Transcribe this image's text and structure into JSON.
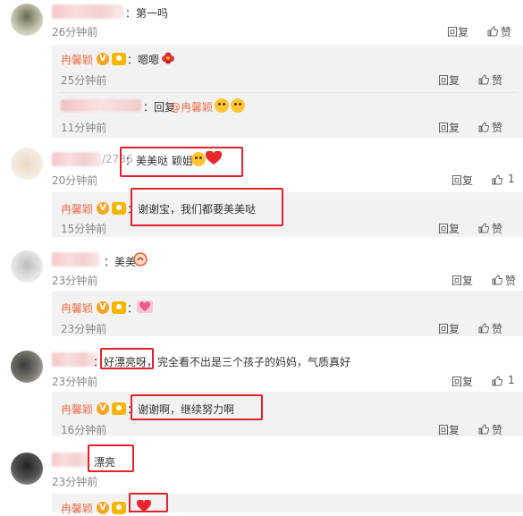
{
  "labels": {
    "reply": "回复",
    "like": "赞",
    "author_name": "冉馨颖"
  },
  "comments": [
    {
      "id": "c1",
      "text": "：第一吗",
      "time": "26分钟前",
      "like_count": ""
    },
    {
      "id": "c2",
      "name_suffix": "/2736",
      "text": "：美美哒 颖姐",
      "time": "20分钟前",
      "like_count": "1"
    },
    {
      "id": "c3",
      "name_suffix": "_",
      "text": "：美美",
      "time": "23分钟前",
      "like_count": ""
    },
    {
      "id": "c4",
      "text_pre": "：",
      "text_hl": "好漂亮呀",
      "text_post": "，完全看不出是三个孩子的妈妈，气质真好",
      "time": "23分钟前",
      "like_count": "1"
    },
    {
      "id": "c5",
      "text_pre": "：",
      "text_hl": "漂亮",
      "time": ""
    }
  ],
  "replies": [
    {
      "id": "r1",
      "text": "：嗯嗯",
      "time": "25分钟前"
    },
    {
      "id": "r2",
      "text": "：回复",
      "mention": "@冉馨颖",
      "time": "11分钟前"
    },
    {
      "id": "r3",
      "text": "：谢谢宝，我们都要美美哒",
      "time": "15分钟前"
    },
    {
      "id": "r4",
      "text": "：",
      "time": "23分钟前"
    },
    {
      "id": "r5",
      "text": "：谢谢啊，继续努力啊",
      "time": "16分钟前"
    },
    {
      "id": "r6",
      "text": "：",
      "time": ""
    }
  ],
  "colors": {
    "highlight": "#e0222b",
    "author": "#eb7350",
    "reply_bg": "#f2f2f2",
    "muted": "#888888"
  }
}
